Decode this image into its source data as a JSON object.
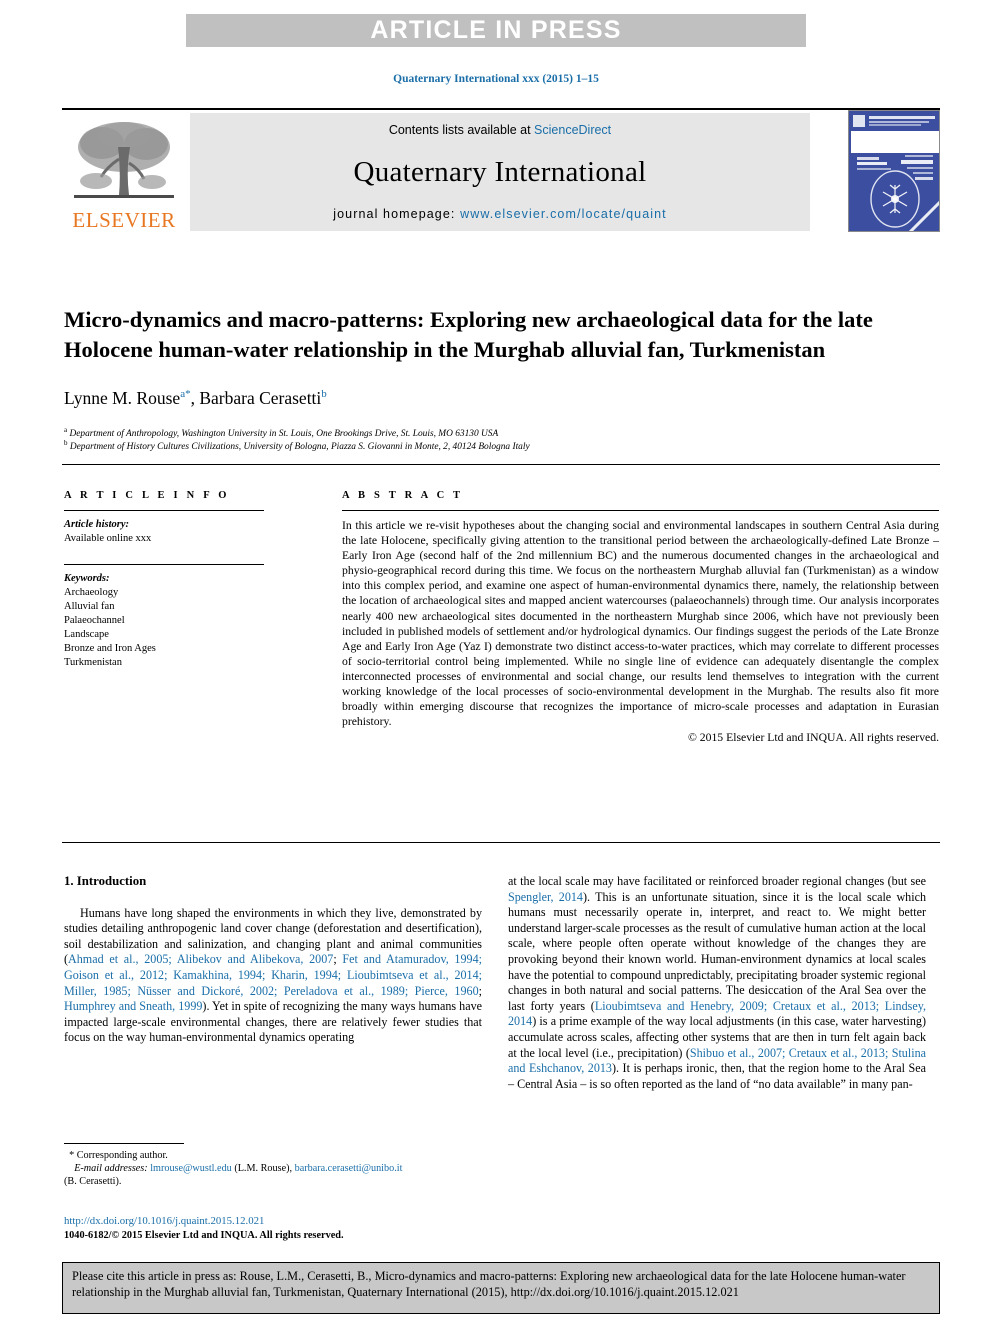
{
  "banner": {
    "text": "ARTICLE IN PRESS"
  },
  "running_head": "Quaternary International xxx (2015) 1–15",
  "masthead": {
    "contents_prefix": "Contents lists available at ",
    "sciencedirect": "ScienceDirect",
    "journal_name": "Quaternary International",
    "homepage_label": "journal homepage: ",
    "homepage_url": "www.elsevier.com/locate/quaint",
    "publisher": "ELSEVIER",
    "cover_title": "QUATERNARY INTERNATIONAL",
    "link_color": "#1a6ea8",
    "elsevier_orange": "#e87722"
  },
  "article": {
    "title": "Micro-dynamics and macro-patterns: Exploring new archaeological data for the late Holocene human-water relationship in the Murghab alluvial fan, Turkmenistan",
    "author1_name": "Lynne M. Rouse",
    "author1_sup": "a",
    "author1_star": "*",
    "author_separator": ", ",
    "author2_name": "Barbara Cerasetti",
    "author2_sup": "b",
    "affiliation_a_marker": "a",
    "affiliation_a": "Department of Anthropology, Washington University in St. Louis, One Brookings Drive, St. Louis, MO 63130 USA",
    "affiliation_b_marker": "b",
    "affiliation_b": "Department of History Cultures Civilizations, University of Bologna, Piazza S. Giovanni in Monte, 2, 40124 Bologna Italy"
  },
  "article_info": {
    "heading": "A R T I C L E  I N F O",
    "history_label": "Article history:",
    "history_value": "Available online xxx",
    "keywords_label": "Keywords:",
    "keywords": [
      "Archaeology",
      "Alluvial fan",
      "Palaeochannel",
      "Landscape",
      "Bronze and Iron Ages",
      "Turkmenistan"
    ]
  },
  "abstract": {
    "heading": "A B S T R A C T",
    "body": "In this article we re-visit hypotheses about the changing social and environmental landscapes in southern Central Asia during the late Holocene, specifically giving attention to the transitional period between the archaeologically-defined Late Bronze – Early Iron Age (second half of the 2nd millennium BC) and the numerous documented changes in the archaeological and physio-geographical record during this time. We focus on the northeastern Murghab alluvial fan (Turkmenistan) as a window into this complex period, and examine one aspect of human-environmental dynamics there, namely, the relationship between the location of archaeological sites and mapped ancient watercourses (palaeochannels) through time. Our analysis incorporates nearly 400 new archaeological sites documented in the northeastern Murghab since 2006, which have not previously been included in published models of settlement and/or hydrological dynamics. Our findings suggest the periods of the Late Bronze Age and Early Iron Age (Yaz I) demonstrate two distinct access-to-water practices, which may correlate to different processes of socio-territorial control being implemented. While no single line of evidence can adequately disentangle the complex interconnected processes of environmental and social change, our results lend themselves to integration with the current working knowledge of the local processes of socio-environmental development in the Murghab. The results also fit more broadly within emerging discourse that recognizes the importance of micro-scale processes and adaptation in Eurasian prehistory.",
    "copyright": "© 2015 Elsevier Ltd and INQUA. All rights reserved."
  },
  "introduction": {
    "heading": "1. Introduction",
    "left_p1_part1": "Humans have long shaped the environments in which they live, demonstrated by studies detailing anthropogenic land cover change (deforestation and desertification), soil destabilization and salinization, and changing plant and animal communities (",
    "left_refs": "Ahmad et al., 2005; Alibekov and Alibekova, 2007",
    "left_p1_part2": "; ",
    "left_refs2": "Fet and Atamuradov, 1994; Goison et al., 2012; Kamakhina, 1994; Kharin, 1994; Lioubimtseva et al., 2014; Miller, 1985; Nüsser and Dickoré, 2002; Pereladova et al., 1989; Pierce, 1960",
    "left_p1_part3": "; ",
    "left_refs3": "Humphrey and Sneath, 1999",
    "left_p1_part4": "). Yet in spite of recognizing the many ways humans have impacted large-scale environmental changes, there are relatively fewer studies that focus on the way human-environmental dynamics operating",
    "right_part1": "at the local scale may have facilitated or reinforced broader regional changes (but see ",
    "right_ref1": "Spengler, 2014",
    "right_part2": "). This is an unfortunate situation, since it is the local scale which humans must necessarily operate in, interpret, and react to. We might better understand larger-scale processes as the result of cumulative human action at the local scale, where people often operate without knowledge of the changes they are provoking beyond their known world. Human-environment dynamics at local scales have the potential to compound unpredictably, precipitating broader systemic regional changes in both natural and social patterns. The desiccation of the Aral Sea over the last forty years (",
    "right_ref2": "Lioubimtseva and Henebry, 2009; Cretaux et al., 2013; Lindsey, 2014",
    "right_part3": ") is a prime example of the way local adjustments (in this case, water harvesting) accumulate across scales, affecting other systems that are then in turn felt again back at the local level (i.e., precipitation) (",
    "right_ref3": "Shibuo et al., 2007; Cretaux et al., 2013; Stulina and Eshchanov, 2013",
    "right_part4": "). It is perhaps ironic, then, that the region home to the Aral Sea – Central Asia – is so often reported as the land of “no data available” in many pan-"
  },
  "footnote": {
    "corresponding_marker": "*",
    "corresponding_text": "Corresponding author.",
    "email_label": "E-mail addresses:",
    "email1": "lmrouse@wustl.edu",
    "email1_attrib": "(L.M. Rouse),",
    "email2": "barbara.cerasetti@unibo.it",
    "email2_attrib": "(B. Cerasetti)."
  },
  "doi": {
    "url": "http://dx.doi.org/10.1016/j.quaint.2015.12.021",
    "issn_line": "1040-6182/© 2015 Elsevier Ltd and INQUA. All rights reserved."
  },
  "citation_box": {
    "text": "Please cite this article in press as: Rouse, L.M., Cerasetti, B., Micro-dynamics and macro-patterns: Exploring new archaeological data for the late Holocene human-water relationship in the Murghab alluvial fan, Turkmenistan, Quaternary International (2015), http://dx.doi.org/10.1016/j.quaint.2015.12.021"
  }
}
